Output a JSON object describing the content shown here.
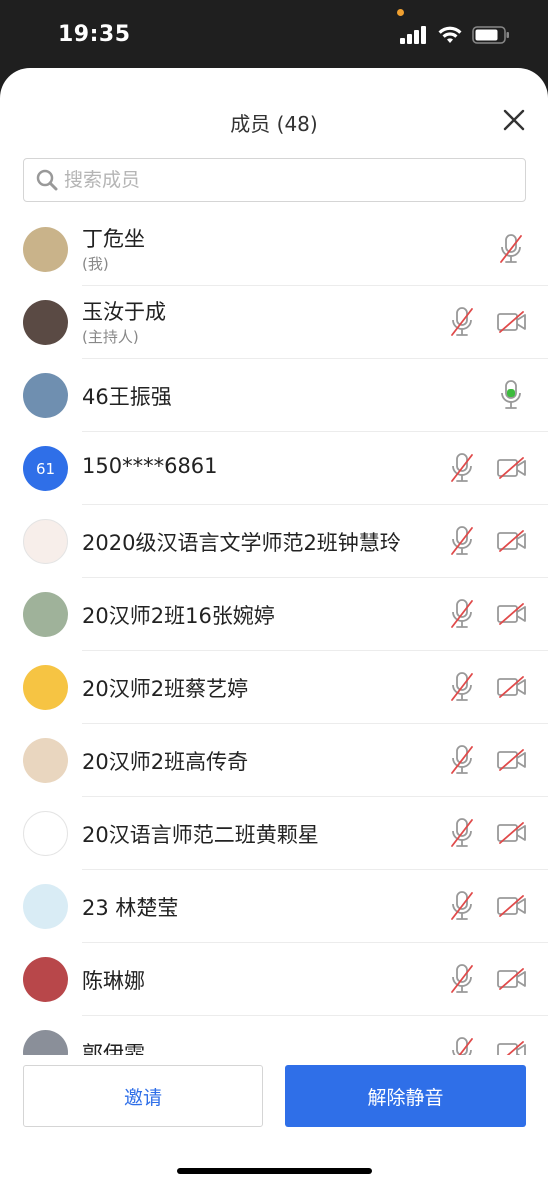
{
  "status_bar": {
    "time": "19:35"
  },
  "sheet": {
    "title": "成员 (48)",
    "search_placeholder": "搜索成员"
  },
  "members": [
    {
      "name": "丁危坐",
      "sub": "(我)",
      "avatar_color": "#c9b38a",
      "mic": "muted",
      "camera": "none"
    },
    {
      "name": "玉汝于成",
      "sub": "(主持人)",
      "avatar_color": "#5a4a44",
      "mic": "muted",
      "camera": "off"
    },
    {
      "name": "46王振强",
      "sub": "",
      "avatar_color": "#6f8fb0",
      "mic": "active",
      "camera": "none"
    },
    {
      "name": "150****6861",
      "sub": "",
      "avatar_text": "61",
      "avatar_color": "#2f6fe8",
      "mic": "muted",
      "camera": "off"
    },
    {
      "name": "2020级汉语言文学师范2班钟慧玲",
      "sub": "",
      "avatar_color": "#f7eeea",
      "mic": "muted",
      "camera": "off"
    },
    {
      "name": "20汉师2班16张婉婷",
      "sub": "",
      "avatar_color": "#9fb29a",
      "mic": "muted",
      "camera": "off"
    },
    {
      "name": "20汉师2班蔡艺婷",
      "sub": "",
      "avatar_color": "#f6c443",
      "mic": "muted",
      "camera": "off"
    },
    {
      "name": "20汉师2班高传奇",
      "sub": "",
      "avatar_color": "#e9d6bf",
      "mic": "muted",
      "camera": "off"
    },
    {
      "name": "20汉语言师范二班黄颗星",
      "sub": "",
      "avatar_color": "#ffffff",
      "mic": "muted",
      "camera": "off"
    },
    {
      "name": "23 林楚莹",
      "sub": "",
      "avatar_color": "#d9ecf5",
      "mic": "muted",
      "camera": "off"
    },
    {
      "name": "陈琳娜",
      "sub": "",
      "avatar_color": "#b8474a",
      "mic": "muted",
      "camera": "off"
    },
    {
      "name": "郭伊霏",
      "sub": "",
      "avatar_color": "#8a8f99",
      "mic": "muted",
      "camera": "off"
    }
  ],
  "buttons": {
    "invite_label": "邀请",
    "unmute_all_label": "解除静音"
  },
  "colors": {
    "accent": "#2f6fe8",
    "mute_red": "#e04a4a",
    "mic_active": "#3dbb3d"
  }
}
